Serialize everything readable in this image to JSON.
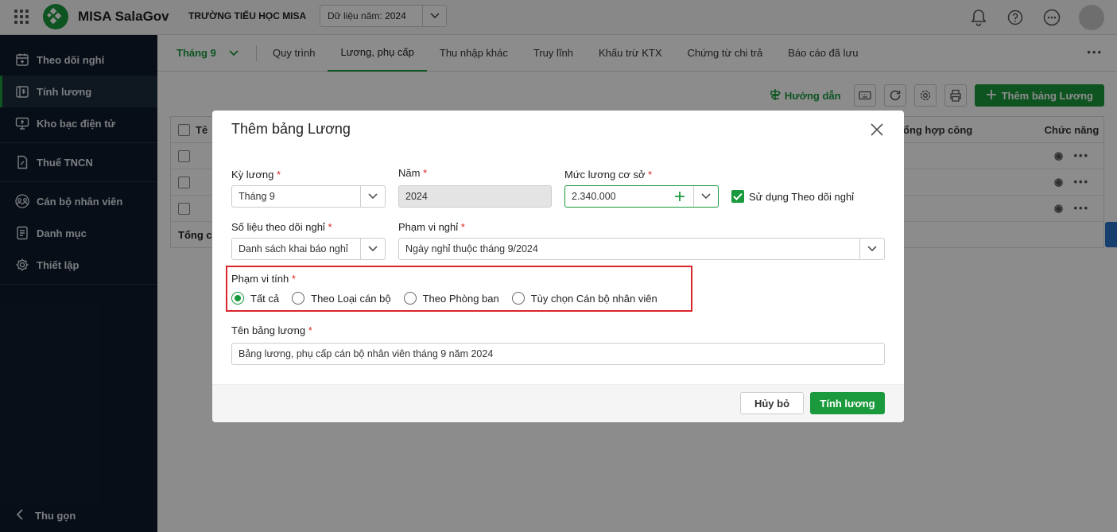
{
  "app": {
    "name": "MISA SalaGov",
    "org": "TRƯỜNG TIỂU HỌC MISA",
    "year_label": "Dữ liệu năm:",
    "year_value": "2024"
  },
  "sidebar": {
    "items": [
      {
        "label": "Theo dõi nghỉ",
        "icon": "calendar-icon"
      },
      {
        "label": "Tính lương",
        "icon": "money-icon"
      },
      {
        "label": "Kho bạc điện tử",
        "icon": "monitor-icon"
      },
      {
        "label": "Thuế TNCN",
        "icon": "document-icon"
      },
      {
        "label": "Cán bộ nhân viên",
        "icon": "people-icon"
      },
      {
        "label": "Danh mục",
        "icon": "list-icon"
      },
      {
        "label": "Thiết lập",
        "icon": "gear-icon"
      }
    ],
    "collapse_label": "Thu gọn"
  },
  "tabs": {
    "month": "Tháng 9",
    "items": [
      "Quy trình",
      "Lương, phụ cấp",
      "Thu nhập khác",
      "Truy lĩnh",
      "Khấu trừ KTX",
      "Chứng từ chi trả",
      "Báo cáo đã lưu"
    ]
  },
  "toolbar": {
    "guide_label": "Hướng dẫn",
    "add_label": "Thêm bảng Lương"
  },
  "grid": {
    "header_left": "Tê",
    "header_mid": "ổng hợp công",
    "header_right": "Chức năng",
    "footer": "Tổng cộ"
  },
  "modal": {
    "title": "Thêm bảng Lương",
    "ky_luong": {
      "label": "Kỳ lương",
      "value": "Tháng 9"
    },
    "nam": {
      "label": "Năm",
      "value": "2024"
    },
    "muc_luong": {
      "label": "Mức lương cơ sở",
      "value": "2.340.000"
    },
    "use_tracking": {
      "label": "Sử dụng Theo dõi nghỉ",
      "checked": true
    },
    "so_lieu": {
      "label": "Số liệu theo dõi nghỉ",
      "value": "Danh sách khai báo nghỉ"
    },
    "pham_vi_nghi": {
      "label": "Phạm vi nghỉ",
      "value": "Ngày nghỉ thuộc tháng 9/2024"
    },
    "pham_vi_tinh": {
      "label": "Phạm vi tính",
      "options": [
        "Tất cả",
        "Theo Loại cán bộ",
        "Theo Phòng ban",
        "Tùy chọn Cán bộ nhân viên"
      ],
      "selected": "Tất cả"
    },
    "ten_bang": {
      "label": "Tên bảng lương",
      "value": "Bảng lương, phụ cấp cán bộ nhân viên tháng 9 năm 2024"
    },
    "cancel_label": "Hủy bỏ",
    "submit_label": "Tính lương"
  },
  "colors": {
    "accent": "#1a9a3c",
    "sidebar_bg": "#0f1b2d",
    "highlight": "#d9262c"
  }
}
